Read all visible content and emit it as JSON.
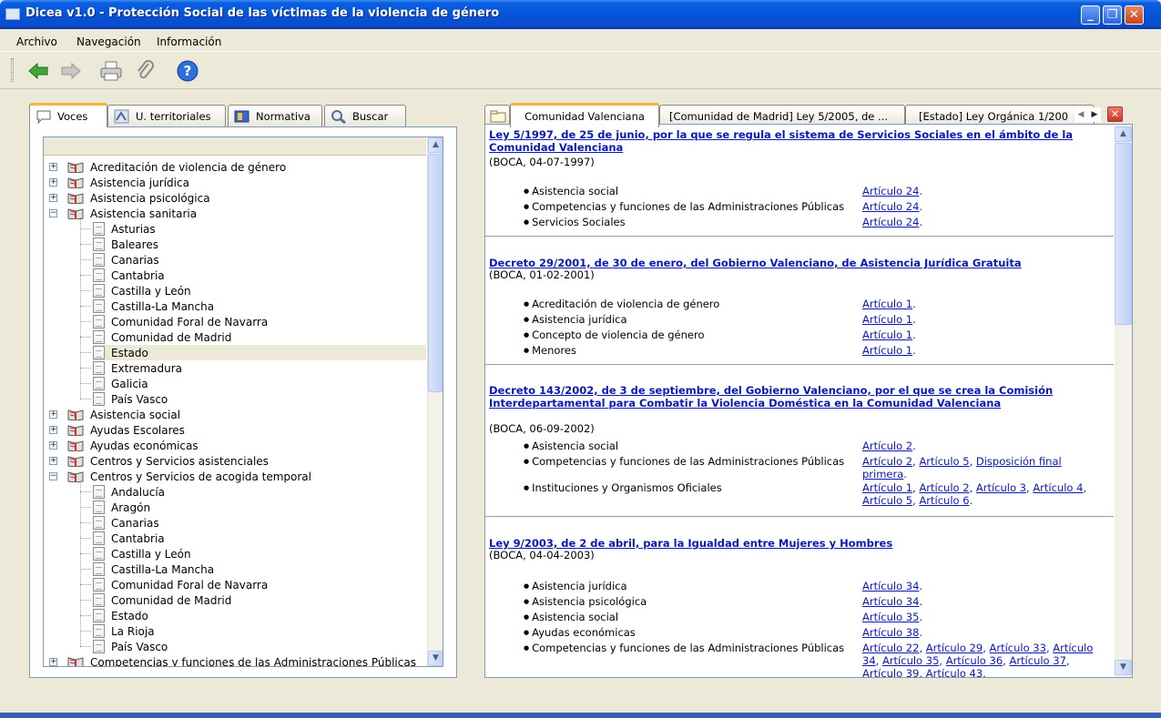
{
  "window": {
    "title": "Dicea v1.0 - Protección Social de las víctimas de la violencia de género"
  },
  "menu": [
    "Archivo",
    "Navegación",
    "Información"
  ],
  "toolbar": {
    "icons": [
      "back-arrow-icon",
      "forward-arrow-icon",
      "printer-icon",
      "paperclip-icon",
      "help-icon"
    ]
  },
  "left_tabs": [
    "Voces",
    "U. territoriales",
    "Normativa",
    "Buscar"
  ],
  "tree": [
    {
      "label": "Acreditación de violencia de género",
      "level": 0,
      "expanded": false
    },
    {
      "label": "Asistencia jurídica",
      "level": 0,
      "expanded": false
    },
    {
      "label": "Asistencia psicológica",
      "level": 0,
      "expanded": false
    },
    {
      "label": "Asistencia sanitaria",
      "level": 0,
      "expanded": true
    },
    {
      "label": "Asturias",
      "level": 1
    },
    {
      "label": "Baleares",
      "level": 1
    },
    {
      "label": "Canarias",
      "level": 1
    },
    {
      "label": "Cantabria",
      "level": 1
    },
    {
      "label": "Castilla y León",
      "level": 1
    },
    {
      "label": "Castilla-La Mancha",
      "level": 1
    },
    {
      "label": "Comunidad Foral de Navarra",
      "level": 1
    },
    {
      "label": "Comunidad de Madrid",
      "level": 1
    },
    {
      "label": "Estado",
      "level": 1,
      "selected": true
    },
    {
      "label": "Extremadura",
      "level": 1
    },
    {
      "label": "Galicia",
      "level": 1
    },
    {
      "label": "País Vasco",
      "level": 1
    },
    {
      "label": "Asistencia social",
      "level": 0,
      "expanded": false
    },
    {
      "label": "Ayudas Escolares",
      "level": 0,
      "expanded": false
    },
    {
      "label": "Ayudas económicas",
      "level": 0,
      "expanded": false
    },
    {
      "label": "Centros y Servicios asistenciales",
      "level": 0,
      "expanded": false
    },
    {
      "label": "Centros y Servicios de acogida temporal",
      "level": 0,
      "expanded": true
    },
    {
      "label": "Andalucía",
      "level": 1
    },
    {
      "label": "Aragón",
      "level": 1
    },
    {
      "label": "Canarias",
      "level": 1
    },
    {
      "label": "Cantabria",
      "level": 1
    },
    {
      "label": "Castilla y León",
      "level": 1
    },
    {
      "label": "Castilla-La Mancha",
      "level": 1
    },
    {
      "label": "Comunidad Foral de Navarra",
      "level": 1
    },
    {
      "label": "Comunidad de Madrid",
      "level": 1
    },
    {
      "label": "Estado",
      "level": 1
    },
    {
      "label": "La Rioja",
      "level": 1
    },
    {
      "label": "País Vasco",
      "level": 1
    },
    {
      "label": "Competencias y funciones de las Administraciones Públicas",
      "level": 0,
      "expanded": false
    }
  ],
  "doc_tabs": [
    "Comunidad Valenciana",
    "[Comunidad de Madrid] Ley 5/2005, de ...",
    "[Estado] Ley Orgánica 1/200"
  ],
  "laws": [
    {
      "title": "Ley 5/1997, de 25 de junio, por la que se regula el sistema de Servicios Sociales en el ámbito de la Comunidad Valenciana",
      "pub": "(BOCA, 04-07-1997)",
      "entries": [
        {
          "topic": "Asistencia social",
          "refs": [
            "Artículo 24"
          ]
        },
        {
          "topic": "Competencias y funciones de las Administraciones Públicas",
          "refs": [
            "Artículo 24"
          ]
        },
        {
          "topic": "Servicios Sociales",
          "refs": [
            "Artículo 24"
          ]
        }
      ]
    },
    {
      "title": "Decreto 29/2001, de 30 de enero, del Gobierno Valenciano, de Asistencia Jurídica Gratuita",
      "pub": "(BOCA, 01-02-2001)",
      "entries": [
        {
          "topic": "Acreditación de violencia de género",
          "refs": [
            "Artículo 1"
          ]
        },
        {
          "topic": "Asistencia jurídica",
          "refs": [
            "Artículo 1"
          ]
        },
        {
          "topic": "Concepto de violencia de género",
          "refs": [
            "Artículo 1"
          ]
        },
        {
          "topic": "Menores",
          "refs": [
            "Artículo 1"
          ]
        }
      ]
    },
    {
      "title": "Decreto 143/2002, de 3 de septiembre, del Gobierno Valenciano, por el que se crea la Comisión Interdepartamental para Combatir la Violencia Doméstica en la Comunidad Valenciana",
      "pub": "(BOCA, 06-09-2002)",
      "entries": [
        {
          "topic": "Asistencia social",
          "refs": [
            "Artículo 2"
          ]
        },
        {
          "topic": "Competencias y funciones de las Administraciones Públicas",
          "refs": [
            "Artículo 2",
            "Artículo 5",
            "Disposición final primera"
          ]
        },
        {
          "topic": "Instituciones y Organismos Oficiales",
          "refs": [
            "Artículo 1",
            "Artículo 2",
            "Artículo 3",
            "Artículo 4",
            "Artículo 5",
            "Artículo 6"
          ]
        }
      ]
    },
    {
      "title": "Ley 9/2003, de 2 de abril, para la Igualdad entre Mujeres y Hombres",
      "pub": "(BOCA, 04-04-2003)",
      "entries": [
        {
          "topic": "Asistencia jurídica",
          "refs": [
            "Artículo 34"
          ]
        },
        {
          "topic": "Asistencia psicológica",
          "refs": [
            "Artículo 34"
          ]
        },
        {
          "topic": "Asistencia social",
          "refs": [
            "Artículo 35"
          ]
        },
        {
          "topic": "Ayudas económicas",
          "refs": [
            "Artículo 38"
          ]
        },
        {
          "topic": "Competencias y funciones de las Administraciones Públicas",
          "refs": [
            "Artículo 22",
            "Artículo 29",
            "Artículo 33",
            "Artículo 34",
            "Artículo 35",
            "Artículo 36",
            "Artículo 37",
            "Artículo 39",
            "Artículo 43"
          ]
        }
      ]
    }
  ],
  "colors": {
    "titlebar": "#0554d8",
    "link": "#0b18b8",
    "active_tab": "#f5b43a",
    "window_bg": "#ece9d8"
  }
}
